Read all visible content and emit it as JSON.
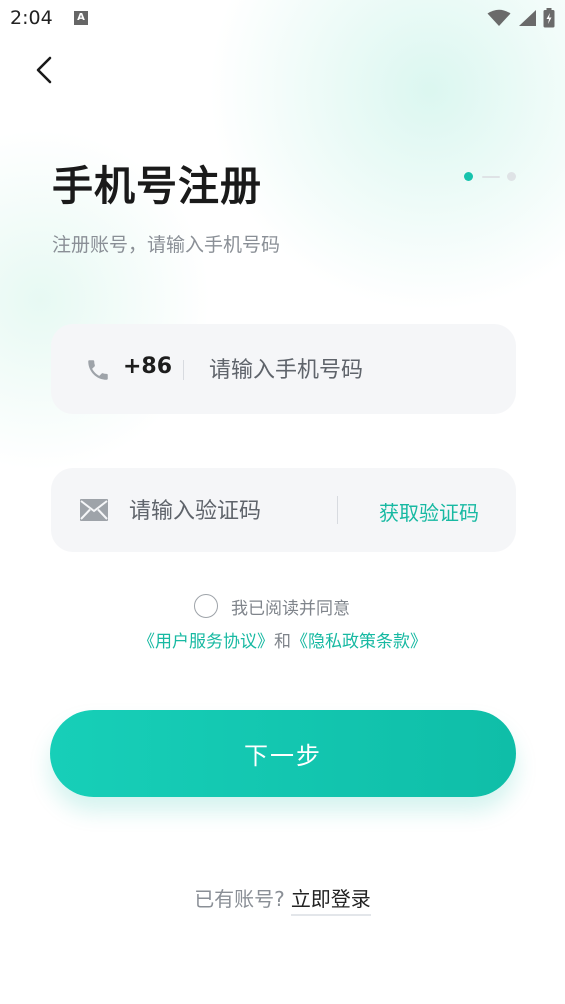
{
  "status_bar": {
    "time": "2:04",
    "notification_icon": "A",
    "icons": [
      "wifi-icon",
      "signal-icon",
      "battery-icon"
    ]
  },
  "header": {
    "back_icon": "chevron-left-icon",
    "title": "手机号注册",
    "subtitle": "注册账号，请输入手机号码",
    "step_indicator": {
      "current": 1,
      "total": 2
    }
  },
  "phone_field": {
    "icon": "phone-icon",
    "prefix": "+86",
    "value": "",
    "placeholder": "请输入手机号码"
  },
  "code_field": {
    "icon": "mail-icon",
    "value": "",
    "placeholder": "请输入验证码",
    "get_code_label": "获取验证码"
  },
  "agreement": {
    "checked": false,
    "text": "我已阅读并同意",
    "user_agreement_label": "《用户服务协议》",
    "and_label": "和",
    "privacy_policy_label": "《隐私政策条款》"
  },
  "next_button": {
    "label": "下一步"
  },
  "footer": {
    "have_account": "已有账号?",
    "login_label": "立即登录"
  },
  "colors": {
    "accent": "#17c3ad",
    "field_bg": "#f5f6f8",
    "title": "#1a1a1a",
    "muted_text": "#8a8f96"
  }
}
